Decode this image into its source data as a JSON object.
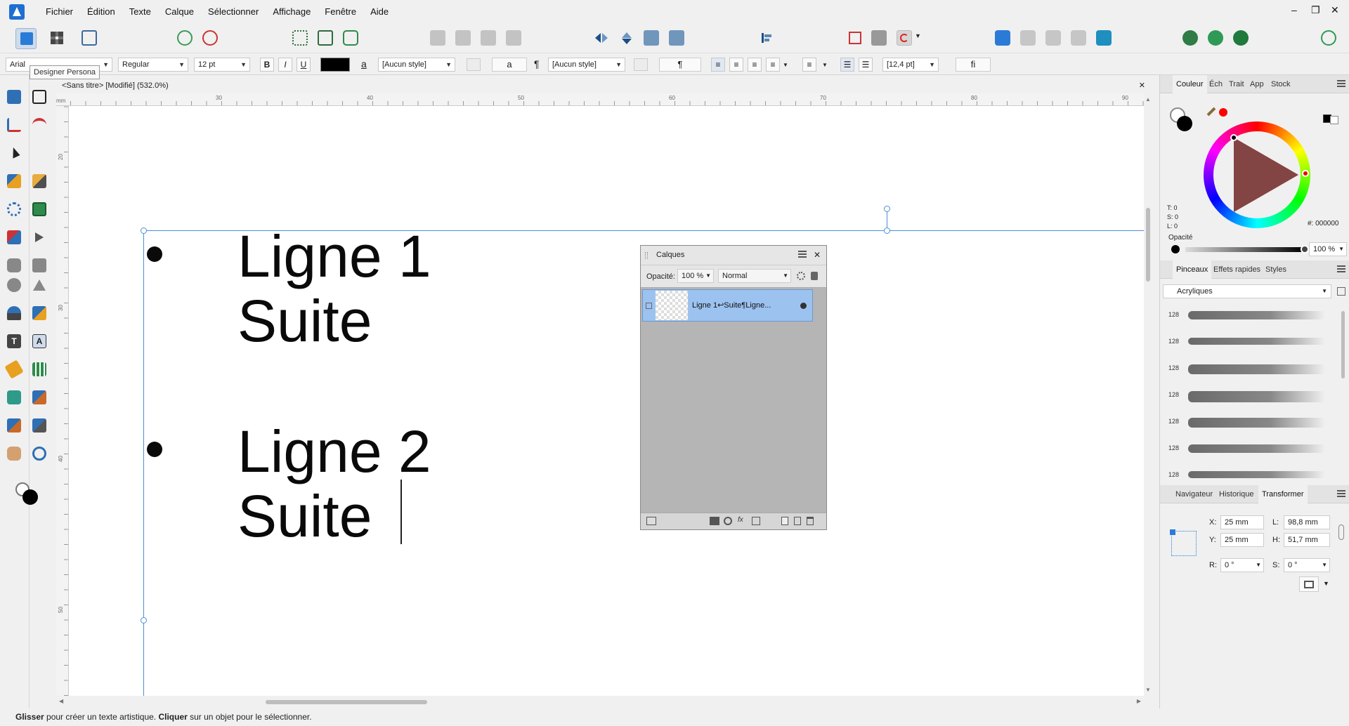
{
  "menubar": {
    "items": [
      "Fichier",
      "Édition",
      "Texte",
      "Calque",
      "Sélectionner",
      "Affichage",
      "Fenêtre",
      "Aide"
    ],
    "window_controls": [
      "–",
      "❐",
      "✕"
    ]
  },
  "tooltip": "Designer Persona",
  "context_toolbar": {
    "font_family": "Arial",
    "font_style": "Regular",
    "font_size": "12 pt",
    "bold": "B",
    "italic": "I",
    "underline": "U",
    "char_style_icon": "a",
    "char_style": "[Aucun style]",
    "para_style_icon": "¶",
    "para_style": "[Aucun style]",
    "pilcrow": "¶",
    "leading": "[12,4 pt]",
    "ligature": "fi",
    "a_button": "a"
  },
  "document": {
    "tab_title": "<Sans titre> [Modifié] (532.0%)",
    "close": "✕",
    "ruler_h": [
      "30",
      "40",
      "50",
      "60",
      "70",
      "80",
      "90"
    ],
    "ruler_v": [
      "20",
      "30",
      "40",
      "50"
    ],
    "ruler_unit": "mm",
    "text_lines": [
      "Ligne 1",
      "Suite",
      "Ligne 2",
      "Suite"
    ]
  },
  "layers_panel": {
    "title": "Calques",
    "opacity_label": "Opacité:",
    "opacity_value": "100 %",
    "blend_mode": "Normal",
    "layer_name": "Ligne 1↩Suite¶Ligne..."
  },
  "color_panel": {
    "tabs": [
      "Couleur",
      "Éch",
      "Trait",
      "App",
      "Stock"
    ],
    "tsl": [
      "T: 0",
      "S: 0",
      "L: 0"
    ],
    "hex": "#: 000000",
    "opacity_label": "Opacité",
    "opacity_value": "100 %",
    "accent": "#ff0000"
  },
  "brushes_panel": {
    "tabs": [
      "Pinceaux",
      "Effets rapides",
      "Styles"
    ],
    "category": "Acryliques",
    "sizes": [
      "128",
      "128",
      "128",
      "128",
      "128",
      "128",
      "128"
    ]
  },
  "transform_panel": {
    "tabs": [
      "Navigateur",
      "Historique",
      "Transformer"
    ],
    "x_label": "X:",
    "x_value": "25 mm",
    "y_label": "Y:",
    "y_value": "25 mm",
    "w_label": "L:",
    "w_value": "98,8 mm",
    "h_label": "H:",
    "h_value": "51,7 mm",
    "r_label": "R:",
    "r_value": "0 °",
    "s_label": "S:",
    "s_value": "0 °"
  },
  "statusbar": {
    "b1": "Glisser",
    "t1": " pour créer un texte artistique. ",
    "b2": "Cliquer",
    "t2": " sur un objet pour le sélectionner."
  }
}
